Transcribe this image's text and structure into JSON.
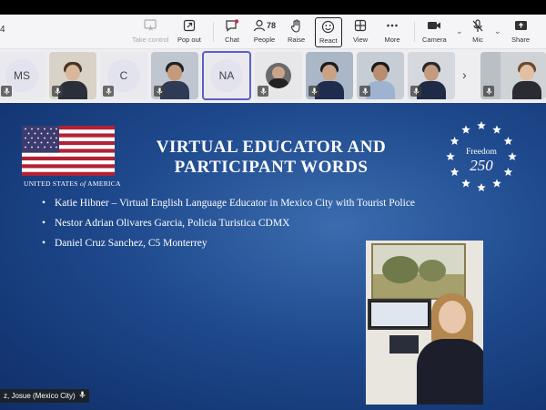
{
  "meeting": {
    "timer": "4"
  },
  "toolbar": {
    "take_control": "Take control",
    "pop_out": "Pop out",
    "chat": "Chat",
    "people_label": "People",
    "people_count": "78",
    "raise": "Raise",
    "react": "React",
    "view": "View",
    "more": "More",
    "camera": "Camera",
    "mic": "Mic",
    "share": "Share"
  },
  "participants": [
    {
      "initials": "MS"
    },
    {
      "initials": ""
    },
    {
      "initials": "C"
    },
    {
      "initials": ""
    },
    {
      "initials": "NA"
    },
    {
      "initials": ""
    },
    {
      "initials": ""
    },
    {
      "initials": ""
    },
    {
      "initials": ""
    },
    {
      "initials": ""
    }
  ],
  "slide": {
    "title": "VIRTUAL EDUCATOR AND PARTICIPANT WORDS",
    "title_line1": "VIRTUAL EDUCATOR AND",
    "title_line2": "PARTICIPANT WORDS",
    "usa_caption_pre": "UNITED STATES ",
    "usa_caption_of": "of",
    "usa_caption_post": " AMERICA",
    "freedom_text": "Freedom",
    "freedom_number": "250",
    "bullets": [
      "Katie Hibner – Virtual English Language Educator in Mexico City with Tourist Police",
      "Nestor Adrian Olivares Garcia, Policia Turistica CDMX",
      "Daniel Cruz Sanchez, C5 Monterrey"
    ]
  },
  "speaker_name_tag": "z, Josue (Mexico City)",
  "colors": {
    "accent": "#5b5fc7",
    "slide_blue": "#1f4a8e",
    "flag_red": "#b22234"
  }
}
